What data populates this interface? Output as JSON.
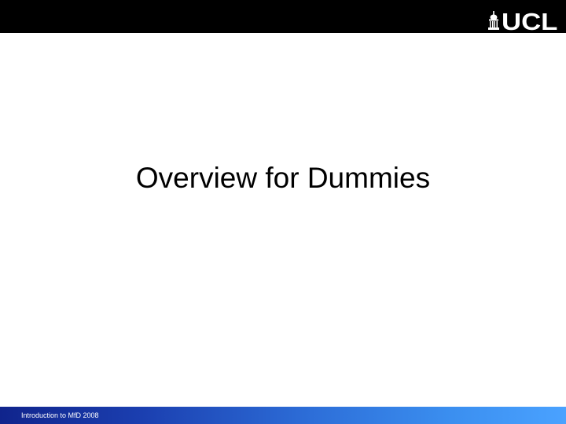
{
  "header": {
    "logo_text": "UCL",
    "background_color": "#000000",
    "logo_icon": "ucl-portico-icon"
  },
  "slide": {
    "title": "Overview for Dummies"
  },
  "footer": {
    "text": "Introduction to MfD 2008",
    "gradient_start": "#10248c",
    "gradient_end": "#4aa2ff"
  }
}
